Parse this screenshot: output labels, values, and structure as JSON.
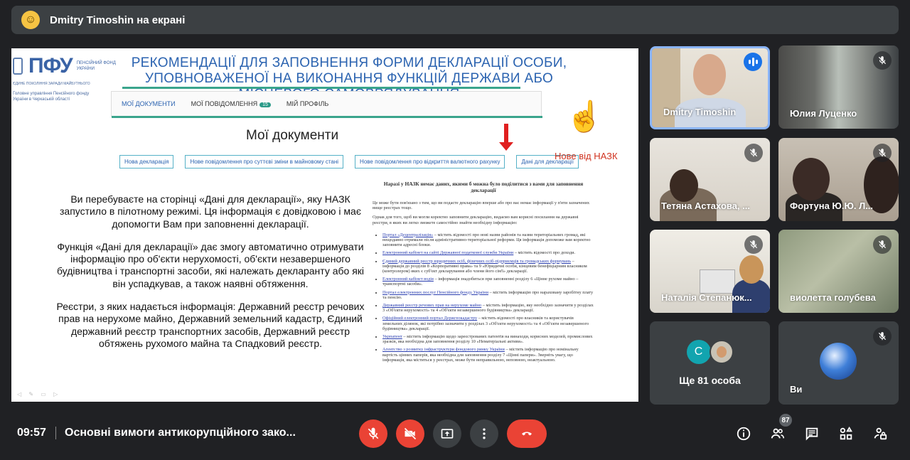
{
  "header": {
    "presenter_label": "Dmitry Timoshin на екрані"
  },
  "slide": {
    "logo_text": "ПФУ",
    "logo_sub": "ПЕНСІЙНИЙ ФОНД УКРАЇНИ",
    "logo_tagline": "ЄДИНЕ ПОКОЛІННЯ ЗАРАДИ МАЙБУТНЬОГО",
    "logo_dept": "Головне управління Пенсійного фонду України в Черкаській області",
    "title": "РЕКОМЕНДАЦІЇ ДЛЯ ЗАПОВНЕННЯ ФОРМИ ДЕКЛАРАЦІЇ ОСОБИ, УПОВНОВАЖЕНОЇ НА ВИКОНАННЯ ФУНКЦІЙ ДЕРЖАВИ АБО МІСЦЕВОГО САМОВРЯДУВАННЯ",
    "portal_tabs": [
      {
        "label": "МОЇ ДОКУМЕНТИ"
      },
      {
        "label": "МОЇ ПОВІДОМЛЕННЯ",
        "badge": "15"
      },
      {
        "label": "МІЙ ПРОФІЛЬ"
      }
    ],
    "docs_title": "Мої документи",
    "buttons": [
      "Нова декларація",
      "Нове повідомлення про суттєві зміни в майновому стані",
      "Нове повідомлення про відкриття валютного рахунку",
      "Дані для декларації"
    ],
    "annotation": "Нове від НАЗК",
    "paragraphs": [
      "Ви перебуваєте на сторінці «Дані для декларації», яку НАЗК запустило в пілотному режимі. Ця інформація є довідковою і має допомогти Вам при заповненні декларації.",
      "Функція «Дані для декларації» дає змогу автоматично отримувати інформацію про об'єкти нерухомості, об'єкти незавершеного будівництва і транспортні засоби, які належать декларанту або які він успадкував, а також наявні обтяження.",
      "Реєстри, з яких надається інформація: Державний реєстр речових прав на нерухоме майно, Державний земельний кадастр, Єдиний державний реєстр транспортних засобів, Державний реєстр обтяжень рухомого майна та Спадковий реєстр."
    ],
    "doc": {
      "heading": "Наразі у НАЗК немає даних, якими б можна було поділитися з вами для заповнення декларації",
      "p1": "Це може бути пов'язано з тим, що ви подаєте декларацію вперше або про вас немає інформації у п'яти зазначених вище реєстрах тощо.",
      "p2": "Однак для того, щоб ви могли коректно заповнити декларацію, видаємо вам корисні посилання на державні реєстри, в яких ви легко зможете самостійно знайти необхідну інформацію:",
      "items": [
        {
          "link": "Портал «Децентралізація»",
          "text": " – містить відомості про нові назви районів та назви територіальних громад, які нещодавно отримали після адміністративно-територіальної реформи. Ця інформація допоможе вам коректно заповнити адресні блоки."
        },
        {
          "link": "Електронний кабінет на сайті Державної податкової служби України",
          "text": " – містить відомості про доходи."
        },
        {
          "link": "Єдиний державний реєстр юридичних осіб, фізичних осіб-підприємців та громадських формувань",
          "text": " – інформація до розділів 8 «Корпоративні права» та 9 «Юридичні особи, кінцевим бенефіціарним власником (контролером) яких є суб'єкт декларування або члени його сім'ї» декларації."
        },
        {
          "link": "Електронний кабінет водія",
          "text": " – інформація знадобиться при заповненні розділу 6 «Цінне рухоме майно – транспортні засоби»."
        },
        {
          "link": "Портал електронних послуг Пенсійного фонду України",
          "text": " – містить інформацію про нараховану заробітну плату та пенсію."
        },
        {
          "link": "Державний реєстр речових прав на нерухоме майно",
          "text": " – містить інформацію, яку необхідно зазначити у розділах 3 «Об'єкти нерухомості» та 4 «Об'єкти незавершеного будівництва» декларації."
        },
        {
          "link": "Офіційний електронний портал Держгеокадастру",
          "text": " – містить відомості про власників та користувачів земельних ділянок, які потрібно зазначити у розділах 3 «Об'єкти нерухомості» та 4 «Об'єкти незавершеного будівництва» декларації."
        },
        {
          "link": "Укрпатент",
          "text": " – містить інформацію щодо зареєстрованих патентів на винаходи, корисних моделей, промислових зразків, яка необхідна для заповнення розділу 10 «Нематеріальні активи»."
        },
        {
          "link": "Агентство з розвитку інфраструктури фондового ринку України",
          "text": " – містить інформацію про номінальну вартість цінних паперів, яка необхідна для заповнення розділу 7 «Цінні папери». Зверніть увагу, що інформація, яка міститься у реєстрах, може бути неправильною, неповною, неактуальною."
        }
      ]
    }
  },
  "participants": [
    {
      "name": "Dmitry Timoshin",
      "speaking": true
    },
    {
      "name": "Юлия Луценко",
      "muted": true
    },
    {
      "name": "Тетяна Астахова, ...",
      "muted": true
    },
    {
      "name": "Фортуна Ю.Ю. Л...",
      "muted": true
    },
    {
      "name": "Наталія Степанюк...",
      "muted": true
    },
    {
      "name": "виолетта голубева",
      "muted": true
    },
    {
      "name": "Ще 81 особа",
      "avatar_letter": "С"
    },
    {
      "name": "Ви",
      "muted": true
    }
  ],
  "bottom": {
    "time": "09:57",
    "meeting_title": "Основні вимоги антикорупційного зако...",
    "participants_count": "87"
  },
  "colors": {
    "end_call": "#ea4335",
    "accent": "#8ab4f8",
    "background": "#202124"
  }
}
